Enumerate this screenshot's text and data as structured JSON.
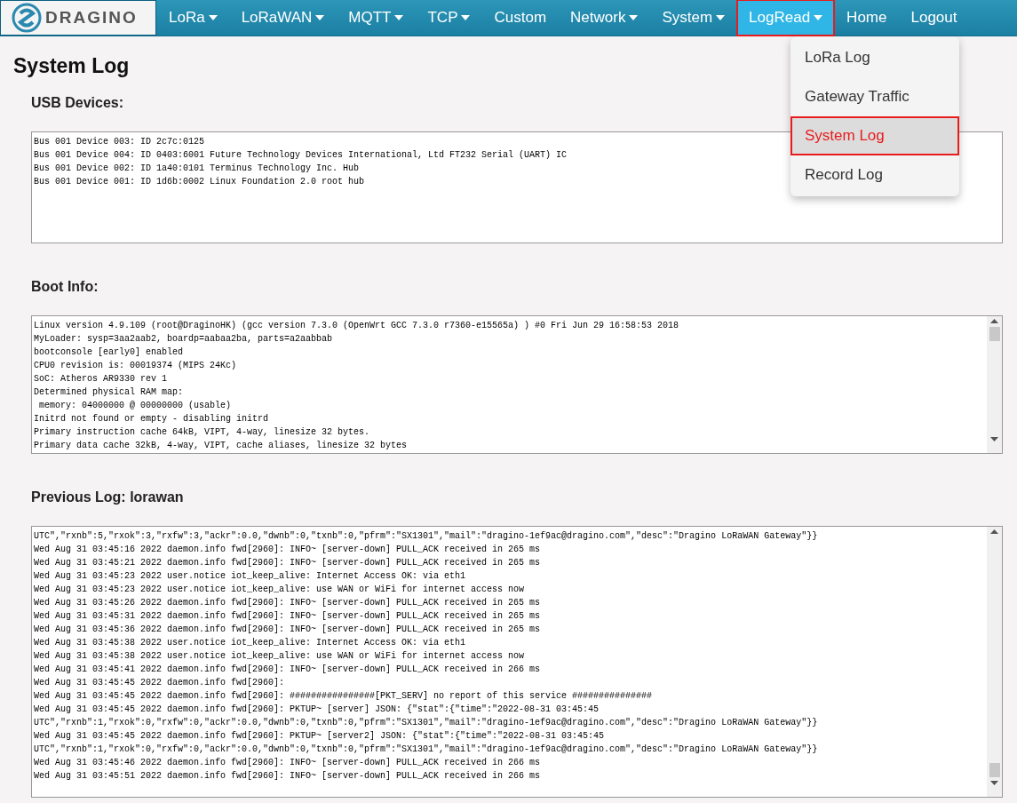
{
  "logo": {
    "text": "DRAGINO"
  },
  "nav": [
    {
      "label": "LoRa",
      "dropdown": true,
      "selected": false,
      "highlighted": false
    },
    {
      "label": "LoRaWAN",
      "dropdown": true,
      "selected": false,
      "highlighted": false
    },
    {
      "label": "MQTT",
      "dropdown": true,
      "selected": false,
      "highlighted": false
    },
    {
      "label": "TCP",
      "dropdown": true,
      "selected": false,
      "highlighted": false
    },
    {
      "label": "Custom",
      "dropdown": false,
      "selected": false,
      "highlighted": false
    },
    {
      "label": "Network",
      "dropdown": true,
      "selected": false,
      "highlighted": false
    },
    {
      "label": "System",
      "dropdown": true,
      "selected": false,
      "highlighted": false
    },
    {
      "label": "LogRead",
      "dropdown": true,
      "selected": true,
      "highlighted": true
    },
    {
      "label": "Home",
      "dropdown": false,
      "selected": false,
      "highlighted": false
    },
    {
      "label": "Logout",
      "dropdown": false,
      "selected": false,
      "highlighted": false
    }
  ],
  "dropdown_menu": [
    {
      "label": "LoRa Log",
      "selected": false,
      "highlighted": false
    },
    {
      "label": "Gateway Traffic",
      "selected": false,
      "highlighted": false
    },
    {
      "label": "System Log",
      "selected": true,
      "highlighted": true
    },
    {
      "label": "Record Log",
      "selected": false,
      "highlighted": false
    }
  ],
  "page_title": "System Log",
  "sections": [
    {
      "title": "USB Devices:",
      "scrollbar": false,
      "lines": [
        "Bus 001 Device 003: ID 2c7c:0125",
        "Bus 001 Device 004: ID 0403:6001 Future Technology Devices International, Ltd FT232 Serial (UART) IC",
        "Bus 001 Device 002: ID 1a40:0101 Terminus Technology Inc. Hub",
        "Bus 001 Device 001: ID 1d6b:0002 Linux Foundation 2.0 root hub"
      ]
    },
    {
      "title": "Boot Info:",
      "scrollbar": true,
      "lines": [
        "Linux version 4.9.109 (root@DraginoHK) (gcc version 7.3.0 (OpenWrt GCC 7.3.0 r7360-e15565a) ) #0 Fri Jun 29 16:58:53 2018",
        "MyLoader: sysp=3aa2aab2, boardp=aabaa2ba, parts=a2aabbab",
        "bootconsole [early0] enabled",
        "CPU0 revision is: 00019374 (MIPS 24Kc)",
        "SoC: Atheros AR9330 rev 1",
        "Determined physical RAM map:",
        " memory: 04000000 @ 00000000 (usable)",
        "Initrd not found or empty - disabling initrd",
        "Primary instruction cache 64kB, VIPT, 4-way, linesize 32 bytes.",
        "Primary data cache 32kB, 4-way, VIPT, cache aliases, linesize 32 bytes"
      ]
    },
    {
      "title": "Previous Log: lorawan",
      "scrollbar": true,
      "lines": [
        "UTC\",\"rxnb\":5,\"rxok\":3,\"rxfw\":3,\"ackr\":0.0,\"dwnb\":0,\"txnb\":0,\"pfrm\":\"SX1301\",\"mail\":\"dragino-1ef9ac@dragino.com\",\"desc\":\"Dragino LoRaWAN Gateway\"}}",
        "Wed Aug 31 03:45:16 2022 daemon.info fwd[2960]: INFO~ [server-down] PULL_ACK received in 265 ms",
        "Wed Aug 31 03:45:21 2022 daemon.info fwd[2960]: INFO~ [server-down] PULL_ACK received in 265 ms",
        "Wed Aug 31 03:45:23 2022 user.notice iot_keep_alive: Internet Access OK: via eth1",
        "Wed Aug 31 03:45:23 2022 user.notice iot_keep_alive: use WAN or WiFi for internet access now",
        "Wed Aug 31 03:45:26 2022 daemon.info fwd[2960]: INFO~ [server-down] PULL_ACK received in 265 ms",
        "Wed Aug 31 03:45:31 2022 daemon.info fwd[2960]: INFO~ [server-down] PULL_ACK received in 265 ms",
        "Wed Aug 31 03:45:36 2022 daemon.info fwd[2960]: INFO~ [server-down] PULL_ACK received in 265 ms",
        "Wed Aug 31 03:45:38 2022 user.notice iot_keep_alive: Internet Access OK: via eth1",
        "Wed Aug 31 03:45:38 2022 user.notice iot_keep_alive: use WAN or WiFi for internet access now",
        "Wed Aug 31 03:45:41 2022 daemon.info fwd[2960]: INFO~ [server-down] PULL_ACK received in 266 ms",
        "Wed Aug 31 03:45:45 2022 daemon.info fwd[2960]:",
        "Wed Aug 31 03:45:45 2022 daemon.info fwd[2960]: ################[PKT_SERV] no report of this service ###############",
        "Wed Aug 31 03:45:45 2022 daemon.info fwd[2960]: PKTUP~ [server] JSON: {\"stat\":{\"time\":\"2022-08-31 03:45:45",
        "UTC\",\"rxnb\":1,\"rxok\":0,\"rxfw\":0,\"ackr\":0.0,\"dwnb\":0,\"txnb\":0,\"pfrm\":\"SX1301\",\"mail\":\"dragino-1ef9ac@dragino.com\",\"desc\":\"Dragino LoRaWAN Gateway\"}}",
        "Wed Aug 31 03:45:45 2022 daemon.info fwd[2960]: PKTUP~ [server2] JSON: {\"stat\":{\"time\":\"2022-08-31 03:45:45",
        "UTC\",\"rxnb\":1,\"rxok\":0,\"rxfw\":0,\"ackr\":0.0,\"dwnb\":0,\"txnb\":0,\"pfrm\":\"SX1301\",\"mail\":\"dragino-1ef9ac@dragino.com\",\"desc\":\"Dragino LoRaWAN Gateway\"}}",
        "Wed Aug 31 03:45:46 2022 daemon.info fwd[2960]: INFO~ [server-down] PULL_ACK received in 266 ms",
        "Wed Aug 31 03:45:51 2022 daemon.info fwd[2960]: INFO~ [server-down] PULL_ACK received in 266 ms"
      ]
    }
  ]
}
